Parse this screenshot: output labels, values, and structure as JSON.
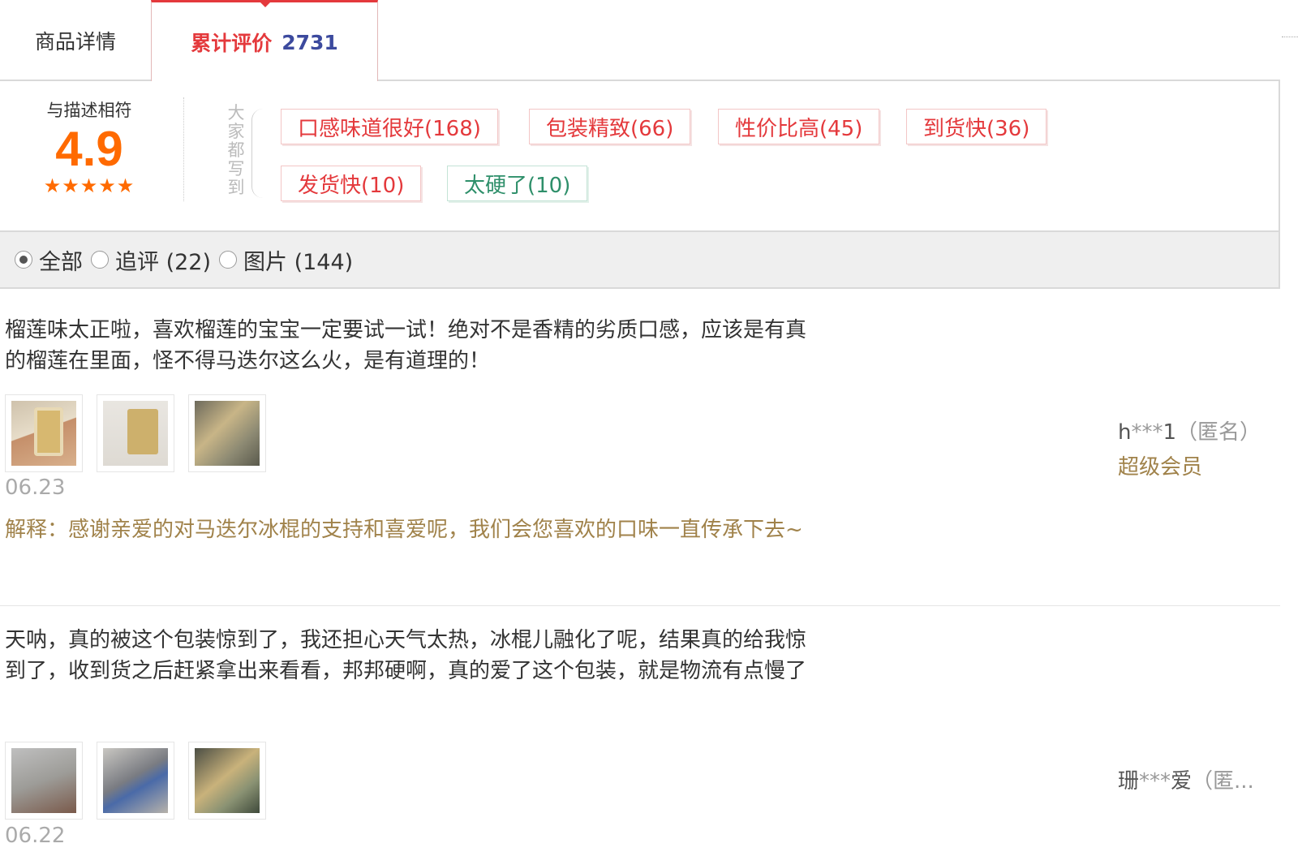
{
  "tabs": {
    "details_label": "商品详情",
    "reviews_label": "累计评价",
    "reviews_count": "2731"
  },
  "rating": {
    "title": "与描述相符",
    "score": "4.9",
    "stars": "★★★★★"
  },
  "impressions": {
    "label": "大家都写到",
    "tags": [
      {
        "text": "口感味道很好(168)",
        "sentiment": "positive"
      },
      {
        "text": "包装精致(66)",
        "sentiment": "positive"
      },
      {
        "text": "性价比高(45)",
        "sentiment": "positive"
      },
      {
        "text": "到货快(36)",
        "sentiment": "positive"
      },
      {
        "text": "发货快(10)",
        "sentiment": "positive"
      },
      {
        "text": "太硬了(10)",
        "sentiment": "negative"
      }
    ]
  },
  "filters": {
    "selected": "全部",
    "options": [
      {
        "label": "全部"
      },
      {
        "label": "追评 (22)"
      },
      {
        "label": "图片 (144)"
      }
    ]
  },
  "reviews": [
    {
      "text": "榴莲味太正啦，喜欢榴莲的宝宝一定要试一试！绝对不是香精的劣质口感，应该是有真的榴莲在里面，怪不得马迭尔这么火，是有道理的！",
      "date": "06.23",
      "reply": "解释：感谢亲爱的对马迭尔冰棍的支持和喜爱呢，我们会您喜欢的口味一直传承下去~",
      "user_prefix": "h",
      "user_mask": "***",
      "user_suffix": "1",
      "user_anon": "（匿名）",
      "level": "超级会员"
    },
    {
      "text": "天呐，真的被这个包装惊到了，我还担心天气太热，冰棍儿融化了呢，结果真的给我惊到了，收到货之后赶紧拿出来看看，邦邦硬啊，真的爱了这个包装，就是物流有点慢了",
      "date": "06.22",
      "user_prefix": "珊",
      "user_mask": "***",
      "user_suffix": "爱",
      "user_anon": "（匿..."
    }
  ],
  "colors": {
    "accent": "#e4393c",
    "score": "#ff6a00",
    "reply": "#a0824a",
    "count": "#3c4a9e"
  }
}
